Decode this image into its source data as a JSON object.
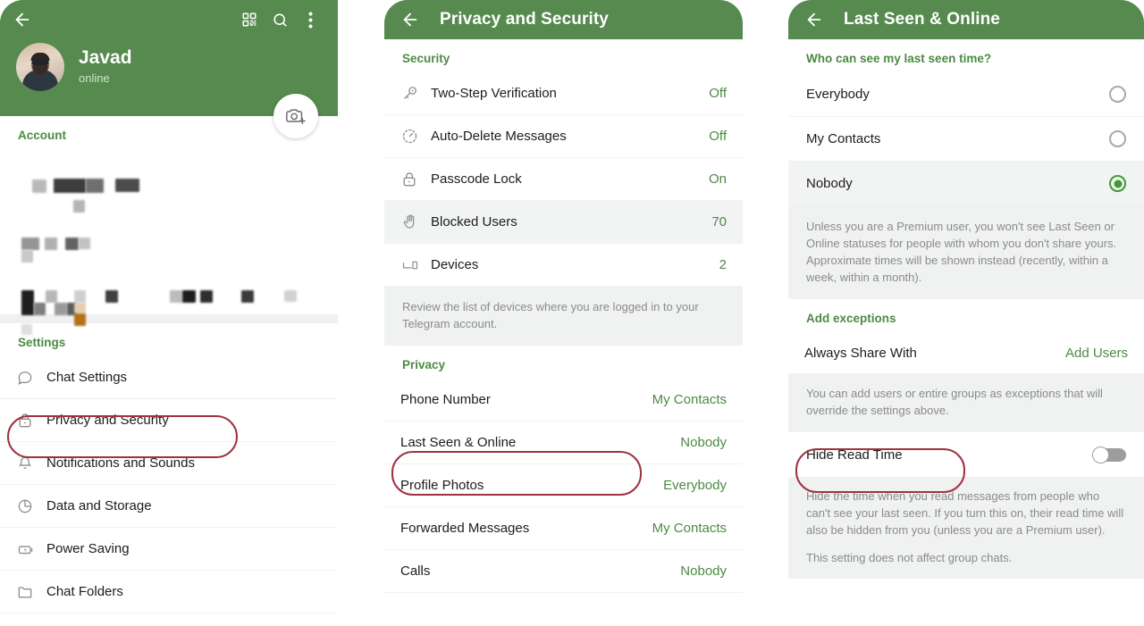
{
  "app": {
    "accent_green": "#568a4f",
    "value_green": "#4c8a43",
    "highlight_red": "#9c3242"
  },
  "panel_profile": {
    "header": {
      "back_icon": "arrow-left-icon",
      "qr_icon": "qr-code-icon",
      "search_icon": "search-icon",
      "more_icon": "more-vertical-icon"
    },
    "user": {
      "name": "Javad",
      "status": "online"
    },
    "camera_button": "add-photo-icon",
    "account_label": "Account",
    "settings_label": "Settings",
    "settings_items": [
      {
        "icon": "chat-bubble-icon",
        "label": "Chat Settings"
      },
      {
        "icon": "lock-icon",
        "label": "Privacy and Security",
        "highlighted": true
      },
      {
        "icon": "bell-icon",
        "label": "Notifications and Sounds"
      },
      {
        "icon": "pie-chart-icon",
        "label": "Data and Storage"
      },
      {
        "icon": "battery-icon",
        "label": "Power Saving"
      },
      {
        "icon": "folder-icon",
        "label": "Chat Folders"
      }
    ]
  },
  "panel_privacy": {
    "title": "Privacy and Security",
    "back_icon": "arrow-left-icon",
    "security_label": "Security",
    "security_items": [
      {
        "icon": "key-icon",
        "label": "Two-Step Verification",
        "value": "Off"
      },
      {
        "icon": "auto-delete-clock-icon",
        "label": "Auto-Delete Messages",
        "value": "Off"
      },
      {
        "icon": "padlock-icon",
        "label": "Passcode Lock",
        "value": "On"
      },
      {
        "icon": "hand-icon",
        "label": "Blocked Users",
        "value": "70",
        "shaded": true
      },
      {
        "icon": "devices-icon",
        "label": "Devices",
        "value": "2"
      }
    ],
    "devices_hint": "Review the list of devices where you are logged in to your Telegram account.",
    "privacy_label": "Privacy",
    "privacy_items": [
      {
        "label": "Phone Number",
        "value": "My Contacts"
      },
      {
        "label": "Last Seen & Online",
        "value": "Nobody",
        "highlighted": true
      },
      {
        "label": "Profile Photos",
        "value": "Everybody"
      },
      {
        "label": "Forwarded Messages",
        "value": "My Contacts"
      },
      {
        "label": "Calls",
        "value": "Nobody"
      }
    ]
  },
  "panel_last_seen": {
    "title": "Last Seen & Online",
    "back_icon": "arrow-left-icon",
    "question_label": "Who can see my last seen time?",
    "options": [
      {
        "label": "Everybody",
        "selected": false
      },
      {
        "label": "My Contacts",
        "selected": false
      },
      {
        "label": "Nobody",
        "selected": true
      }
    ],
    "premium_hint": "Unless you are a Premium user, you won't see Last Seen or Online statuses for people with whom you don't share yours. Approximate times will be shown instead (recently, within a week, within a month).",
    "exceptions_label": "Add exceptions",
    "always_share": {
      "label": "Always Share With",
      "action": "Add Users"
    },
    "exceptions_hint": "You can add users or entire groups as exceptions that will override the settings above.",
    "hide_read_time": {
      "label": "Hide Read Time",
      "enabled": false,
      "highlighted": true
    },
    "read_time_hint": "Hide the time when you read messages from people who can't see your last seen. If you turn this on, their read time will also be hidden from you (unless you are a Premium user).",
    "group_chat_hint": "This setting does not affect group chats."
  }
}
